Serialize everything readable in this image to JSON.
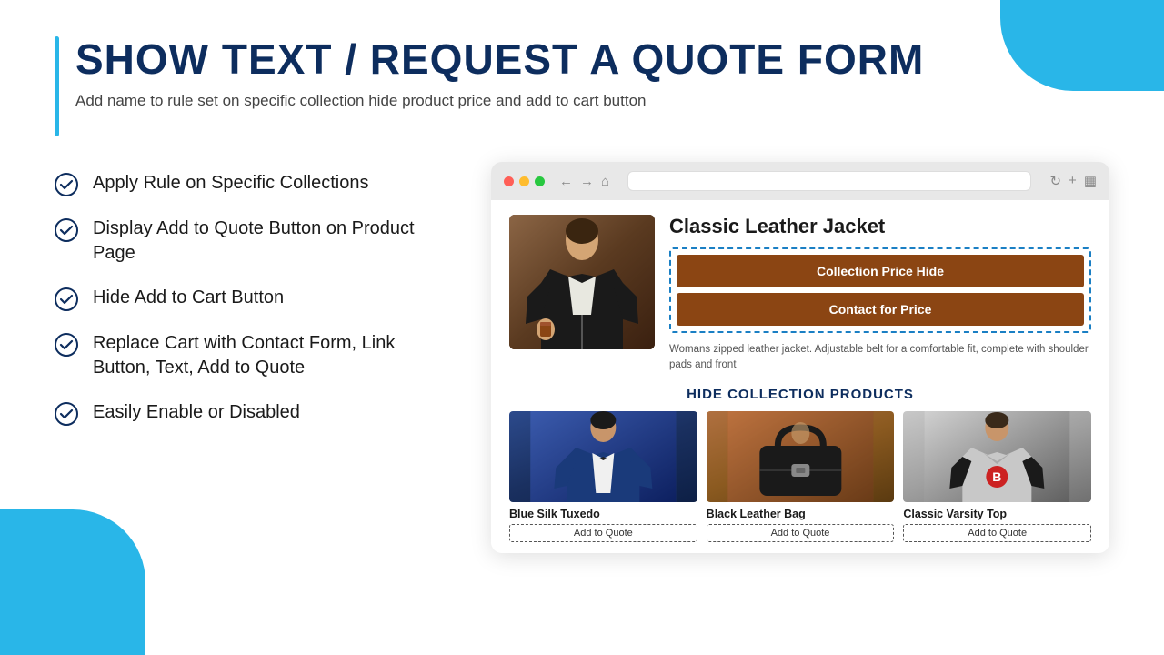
{
  "header": {
    "title": "SHOW TEXT / REQUEST A QUOTE FORM",
    "subtitle": "Add name to rule set on specific collection hide product price and add to cart button",
    "bar_color": "#29b6e8"
  },
  "features": [
    {
      "id": "apply-rule",
      "text": "Apply Rule on Specific Collections"
    },
    {
      "id": "display-add",
      "text": "Display Add to Quote Button on Product Page"
    },
    {
      "id": "hide-cart",
      "text": "Hide Add to Cart Button"
    },
    {
      "id": "replace-cart",
      "text": "Replace Cart with Contact Form, Link Button, Text, Add to Quote"
    },
    {
      "id": "enable-disable",
      "text": "Easily Enable or Disabled"
    }
  ],
  "browser": {
    "product": {
      "title": "Classic Leather Jacket",
      "button1": "Collection Price Hide",
      "button2": "Contact for Price",
      "description": "Womans zipped leather jacket. Adjustable belt for a comfortable fit, complete with shoulder pads and front"
    },
    "collection_title": "HIDE COLLECTION PRODUCTS",
    "collection_items": [
      {
        "id": "tuxedo",
        "name": "Blue Silk Tuxedo",
        "btn": "Add to Quote"
      },
      {
        "id": "bag",
        "name": "Black Leather Bag",
        "btn": "Add to Quote"
      },
      {
        "id": "varsity",
        "name": "Classic Varsity Top",
        "btn": "Add to Quote"
      }
    ]
  },
  "icons": {
    "check": "✓",
    "dot_red": "#ff5f57",
    "dot_yellow": "#febc2e",
    "dot_green": "#28c840"
  }
}
